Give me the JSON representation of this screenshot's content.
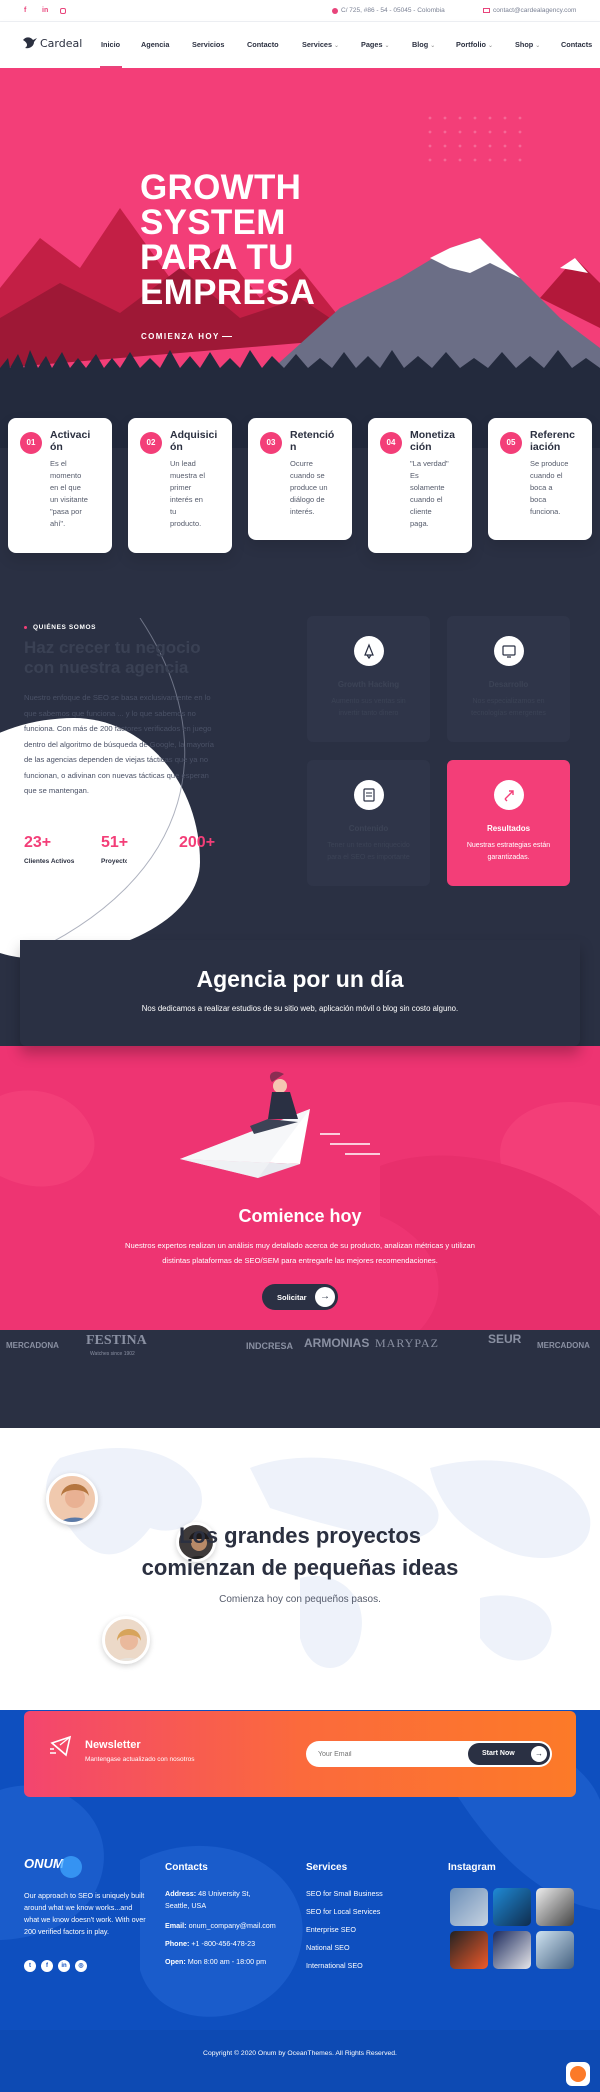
{
  "topbar": {
    "address": "C/ 725, #86 - 54 - 05045 - Colombia",
    "email": "contact@cardealagency.com"
  },
  "nav": {
    "logo": "Cardeal",
    "items": [
      {
        "label": "Inicio"
      },
      {
        "label": "Agencia"
      },
      {
        "label": "Servicios"
      },
      {
        "label": "Contacto"
      },
      {
        "label": "Services",
        "dropdown": true
      },
      {
        "label": "Pages",
        "dropdown": true
      },
      {
        "label": "Blog",
        "dropdown": true
      },
      {
        "label": "Portfolio",
        "dropdown": true
      },
      {
        "label": "Shop",
        "dropdown": true
      },
      {
        "label": "Contacts"
      }
    ]
  },
  "hero": {
    "title_lines": [
      "GROWTH",
      "SYSTEM",
      "PARA TU",
      "EMPRESA"
    ],
    "cta": "COMIENZA HOY"
  },
  "features": [
    {
      "num": "01",
      "title_lines": [
        "Activaci",
        "ón"
      ],
      "desc_lines": [
        "Es el",
        "momento",
        "en el que",
        "un visitante",
        "\"pasa por",
        "ahí\"."
      ]
    },
    {
      "num": "02",
      "title_lines": [
        "Adquisici",
        "ón"
      ],
      "desc_lines": [
        "Un lead",
        "muestra el",
        "primer",
        "interés en",
        "tu",
        "producto."
      ]
    },
    {
      "num": "03",
      "title_lines": [
        "Retenció",
        "n"
      ],
      "desc_lines": [
        "Ocurre",
        "cuando se",
        "produce un",
        "diálogo de",
        "interés."
      ]
    },
    {
      "num": "04",
      "title_lines": [
        "Monetiza",
        "ción"
      ],
      "desc_lines": [
        "\"La verdad\"",
        "Es",
        "solamente",
        "cuando el",
        "cliente",
        "paga."
      ]
    },
    {
      "num": "05",
      "title_lines": [
        "Referenc",
        "iación"
      ],
      "desc_lines": [
        "Se produce",
        "cuando el",
        "boca a",
        "boca",
        "funciona."
      ]
    }
  ],
  "about": {
    "subtitle": "QUIÉNES SOMOS",
    "title_lines": [
      "Haz crecer tu negocio",
      "con nuestra agencia"
    ],
    "text_lines": [
      "Nuestro enfoque de SEO se basa exclusivamente en lo",
      "que sabemos que funciona ... y lo que sabemos no",
      "funciona. Con más de 200 factores verificados en juego",
      "dentro del algoritmo de búsqueda de Google, la mayoría",
      "de las agencias dependen de viejas tácticas que ya no",
      "funcionan, o adivinan con nuevas tácticas que esperan",
      "que se mantengan."
    ],
    "stats": [
      {
        "value": "23+",
        "label": "Clientes Activos"
      },
      {
        "value": "51+",
        "label": "Proyectos"
      },
      {
        "value": "200+",
        "label": ""
      }
    ]
  },
  "services": [
    {
      "title": "Growth Hacking",
      "desc_lines": [
        "Aumento sus ventas sin",
        "invertir tanto dinero"
      ],
      "icon": "rocket-icon"
    },
    {
      "title": "Desarrollo",
      "desc_lines": [
        "Nos especializamos en",
        "tecnologías emergentes"
      ],
      "icon": "monitor-icon"
    },
    {
      "title": "Contenido",
      "desc_lines": [
        "Tener un texto enriquecido",
        "para el SEO es importante"
      ],
      "icon": "document-icon"
    },
    {
      "title": "Resultados",
      "desc_lines": [
        "Nuestras estrategias están",
        "garantizadas."
      ],
      "icon": "rocket-icon"
    }
  ],
  "agency": {
    "title": "Agencia por un día",
    "subtitle": "Nos dedicamos a realizar estudios de su sitio web, aplicación móvil o blog sin costo alguno."
  },
  "cta": {
    "title": "Comience hoy",
    "text_lines": [
      "Nuestros expertos realizan un análisis muy detallado acerca de su producto, analizan métricas y utilizan",
      "distintas plataformas de SEO/SEM para entregarle las mejores recomendaciones."
    ],
    "button": "Solicitar"
  },
  "brands": [
    "MERCADONA",
    "FESTINA",
    "Watches since 1902",
    "INDCRESA",
    "ARMONIAS",
    "MARYPAZ",
    "SEUR",
    "MERCADONA"
  ],
  "ideas": {
    "title_lines": [
      "Los grandes proyectos",
      "comienzan de pequeñas ideas"
    ],
    "subtitle": "Comienza hoy con pequeños pasos."
  },
  "newsletter": {
    "title": "Newsletter",
    "subtitle": "Mantengase actualizado con nosotros",
    "placeholder": "Your Email",
    "button": "Start Now"
  },
  "footer": {
    "logo": "ONUM",
    "about_lines": [
      "Our approach to SEO is uniquely built",
      "around what we know works...and",
      "what we know doesn't work. With over",
      "200 verified factors in play."
    ],
    "contacts_title": "Contacts",
    "address_label": "Address:",
    "address_line1": "48 University St,",
    "address_line2": "Seattle, USA",
    "email_label": "Email:",
    "email": "onum_company@mail.com",
    "phone_label": "Phone:",
    "phone": "+1 -800-456-478-23",
    "open_label": "Open:",
    "open": "Mon 8:00 am - 18:00 pm",
    "services_title": "Services",
    "services": [
      "SEO for Small Business",
      "SEO for Local Services",
      "Enterprise SEO",
      "National SEO",
      "International SEO"
    ],
    "instagram_title": "Instagram",
    "copyright": "Copyright © 2020 Onum by OceanThemes. All Rights Reserved."
  },
  "colors": {
    "accent": "#f33e78",
    "dark": "#2a3043",
    "footer": "#0e4fbf",
    "orange": "#fc7a28"
  }
}
